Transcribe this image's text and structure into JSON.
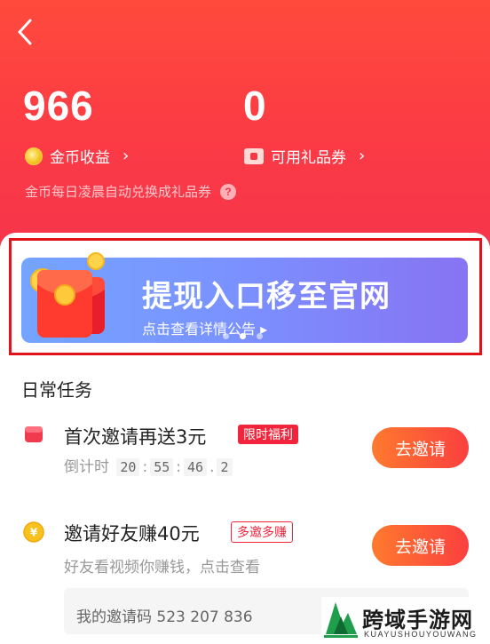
{
  "header": {
    "coins": {
      "value": "966",
      "label": "金币收益"
    },
    "vouchers": {
      "value": "0",
      "label": "可用礼品券"
    },
    "note": "金币每日凌晨自动兑换成礼品券"
  },
  "banner": {
    "title": "提现入口移至官网",
    "subtitle": "点击查看详情公告 ▸",
    "active_dot": 1
  },
  "section": {
    "title": "日常任务"
  },
  "tasks": [
    {
      "title": "首次邀请再送3元",
      "tag": "限时福利",
      "countdown_label": "倒计时",
      "countdown": [
        "20",
        "55",
        "46",
        "2"
      ],
      "button": "去邀请"
    },
    {
      "title": "邀请好友赚40元",
      "tag": "多邀多赚",
      "subtitle": "好友看视频你赚钱，点击查看",
      "button": "去邀请"
    }
  ],
  "invite": {
    "label": "我的邀请码",
    "code": "523 207 836"
  },
  "watermark": {
    "title": "跨域手游网",
    "subtitle": "KUAYUSHOUYOUWANG"
  },
  "colors": {
    "header_top": "#ff4a3c",
    "header_bottom": "#f5344d",
    "accent_red": "#f2243b",
    "button_start": "#ff7a2e",
    "button_end": "#fb3f3f",
    "banner_start": "#74a4ff",
    "banner_end": "#8773f3",
    "highlight_frame": "#e0121a"
  }
}
